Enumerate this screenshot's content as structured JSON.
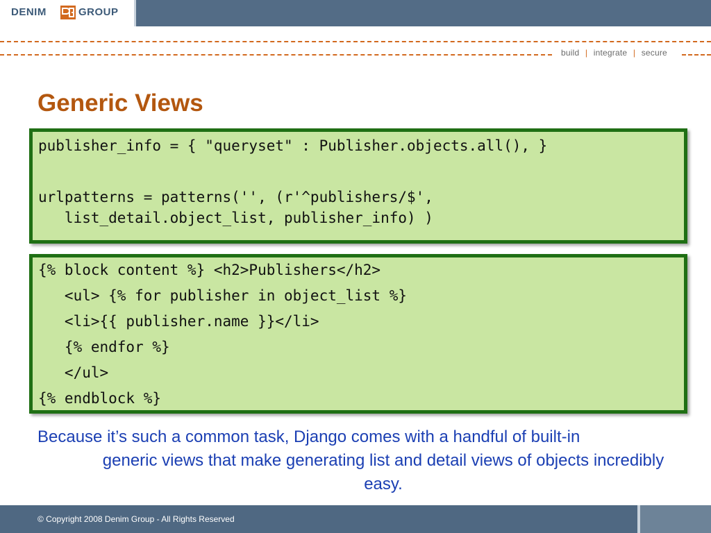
{
  "header": {
    "logo": {
      "left_text": "DENIM",
      "right_text": "GROUP",
      "mark": "denim-group-logo-mark"
    },
    "tagline": {
      "items": [
        "build",
        "integrate",
        "secure"
      ],
      "separator": "|"
    },
    "colors": {
      "bar": "#4f6882",
      "accent": "#d2691e"
    }
  },
  "slide": {
    "title": "Generic Views",
    "code_block_1": {
      "lines": [
        "publisher_info = { \"queryset\" : Publisher.objects.all(), }",
        "",
        "urlpatterns = patterns('', (r'^publishers/$',",
        "   list_detail.object_list, publisher_info) )"
      ]
    },
    "code_block_2": {
      "lines": [
        "{% block content %} <h2>Publishers</h2>",
        "   <ul> {% for publisher in object_list %}",
        "   <li>{{ publisher.name }}</li>",
        "   {% endfor %}",
        "   </ul>",
        "{% endblock %}"
      ]
    },
    "description": {
      "first_line": "Because it’s such a common task, Django comes with a handful of built-in",
      "rest": "generic views that make generating list and detail views of objects incredibly easy."
    },
    "colors": {
      "title": "#b3570f",
      "code_bg": "#c9e6a2",
      "code_border": "#1f6f14",
      "text": "#1b3fb3"
    }
  },
  "footer": {
    "copyright": "© Copyright 2008 Denim Group - All Rights Reserved"
  }
}
